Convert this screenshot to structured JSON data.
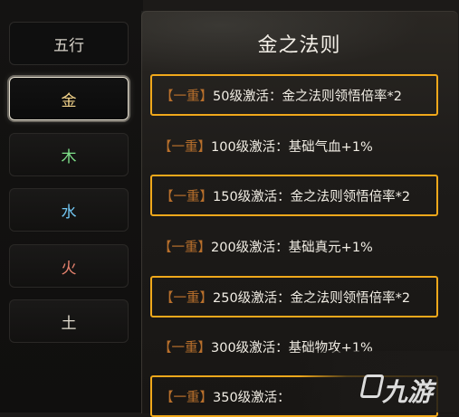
{
  "sidebar": {
    "header": "五行",
    "tabs": [
      {
        "label": "金",
        "color": "#f3d38a",
        "active": true
      },
      {
        "label": "木",
        "color": "#7fe08a",
        "active": false
      },
      {
        "label": "水",
        "color": "#72c6f2",
        "active": false
      },
      {
        "label": "火",
        "color": "#e8836f",
        "active": false
      },
      {
        "label": "土",
        "color": "#e2dccf",
        "active": false
      }
    ]
  },
  "panel": {
    "title": "金之法则",
    "rules": [
      {
        "tag": "【一重】",
        "text": "50级激活：金之法则领悟倍率*2",
        "highlighted": true
      },
      {
        "tag": "【一重】",
        "text": "100级激活：基础气血+1%",
        "highlighted": false
      },
      {
        "tag": "【一重】",
        "text": "150级激活：金之法则领悟倍率*2",
        "highlighted": true
      },
      {
        "tag": "【一重】",
        "text": "200级激活：基础真元+1%",
        "highlighted": false
      },
      {
        "tag": "【一重】",
        "text": "250级激活：金之法则领悟倍率*2",
        "highlighted": true
      },
      {
        "tag": "【一重】",
        "text": "300级激活：基础物攻+1%",
        "highlighted": false
      },
      {
        "tag": "【一重】",
        "text": "350级激活：",
        "highlighted": true
      }
    ]
  },
  "watermark": {
    "logo": "九游"
  },
  "colors": {
    "highlight_border": "#f0a81b",
    "tag_color": "#b9702c"
  }
}
